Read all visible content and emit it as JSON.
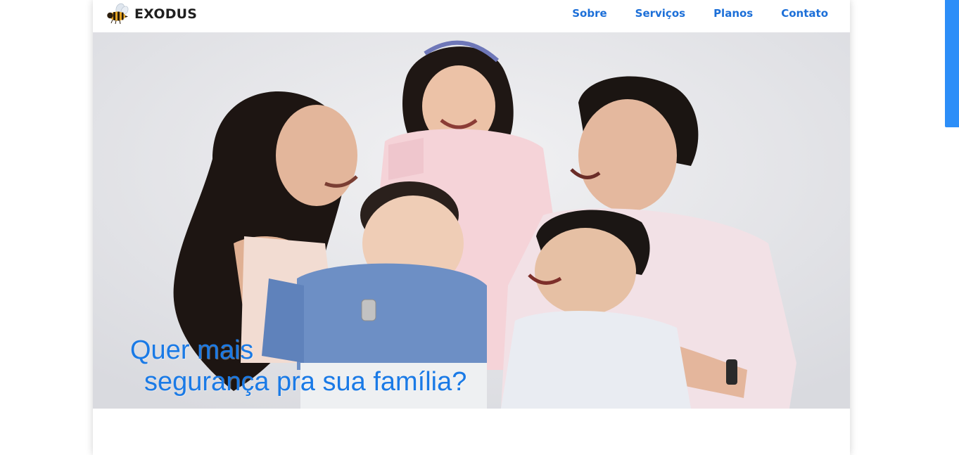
{
  "brand": {
    "name": "EXODUS",
    "logo_icon": "bee-icon"
  },
  "nav": {
    "items": [
      {
        "label": "Sobre"
      },
      {
        "label": "Serviços"
      },
      {
        "label": "Planos"
      },
      {
        "label": "Contato"
      }
    ]
  },
  "hero": {
    "image": "family-photo",
    "headline_line1": "Quer mais",
    "headline_line2": "segurança pra sua família?"
  },
  "colors": {
    "accent": "#1c6fd8",
    "headline": "#1a7ae6",
    "scrollbar": "#2c8ef8",
    "brand_text": "#1f1f1f"
  }
}
